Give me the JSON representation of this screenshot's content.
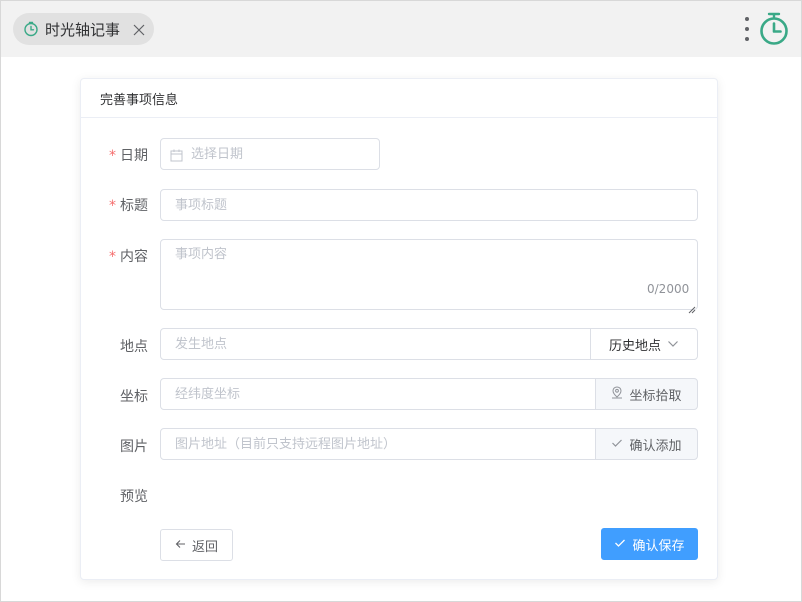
{
  "tab": {
    "label": "时光轴记事"
  },
  "card": {
    "title": "完善事项信息"
  },
  "form": {
    "required_mark": "*",
    "date": {
      "label": "日期",
      "placeholder": "选择日期"
    },
    "title": {
      "label": "标题",
      "placeholder": "事项标题"
    },
    "content": {
      "label": "内容",
      "placeholder": "事项内容",
      "counter": "0/2000"
    },
    "location": {
      "label": "地点",
      "placeholder": "发生地点",
      "append_label": "历史地点"
    },
    "coordinate": {
      "label": "坐标",
      "placeholder": "经纬度坐标",
      "append_label": "坐标拾取"
    },
    "image": {
      "label": "图片",
      "placeholder": "图片地址（目前只支持远程图片地址）",
      "append_label": "确认添加"
    },
    "preview": {
      "label": "预览"
    }
  },
  "actions": {
    "back_label": "返回",
    "save_label": "确认保存"
  },
  "colors": {
    "brand": "#3aa987",
    "primary": "#409eff",
    "required": "#f56c6c"
  }
}
